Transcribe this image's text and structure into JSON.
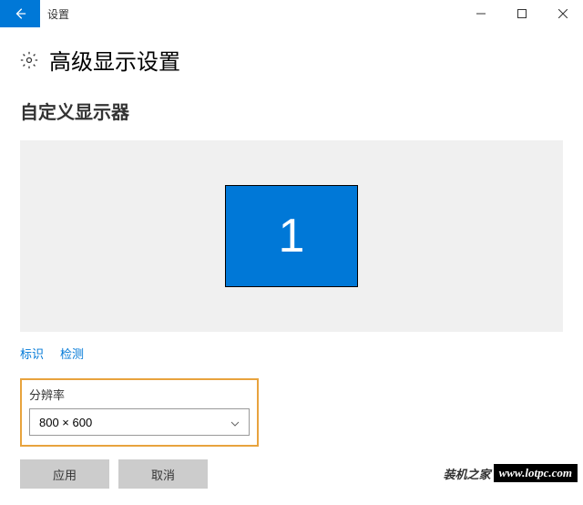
{
  "titlebar": {
    "app_label": "设置"
  },
  "page": {
    "title": "高级显示设置"
  },
  "section": {
    "title": "自定义显示器"
  },
  "monitor": {
    "number": "1"
  },
  "links": {
    "identify": "标识",
    "detect": "检测"
  },
  "resolution": {
    "label": "分辨率",
    "value": "800 × 600"
  },
  "buttons": {
    "apply": "应用",
    "cancel": "取消"
  },
  "watermark": {
    "cn": "装机之家",
    "en": "www.lotpc.com"
  }
}
